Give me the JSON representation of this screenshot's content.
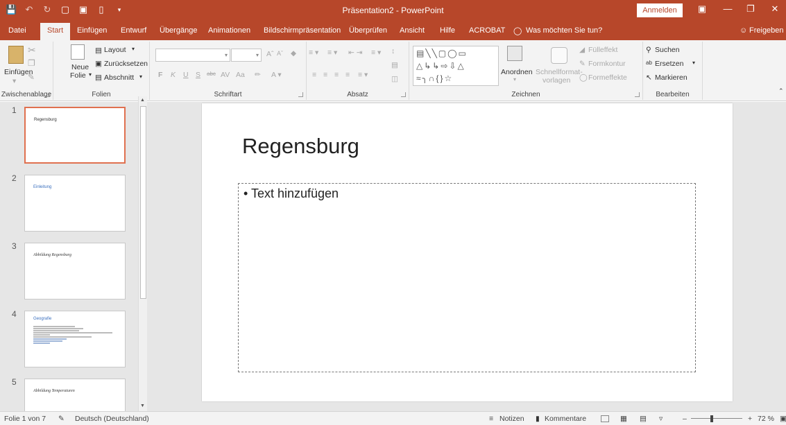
{
  "titlebar": {
    "title": "Präsentation2 - PowerPoint",
    "signin": "Anmelden"
  },
  "tabs": [
    "Datei",
    "Start",
    "Einfügen",
    "Entwurf",
    "Übergänge",
    "Animationen",
    "Bildschirmpräsentation",
    "Überprüfen",
    "Ansicht",
    "Hilfe",
    "ACROBAT"
  ],
  "tell_me": "Was möchten Sie tun?",
  "share": "Freigeben",
  "ribbon": {
    "clipboard": {
      "paste": "Einfügen",
      "label": "Zwischenablage"
    },
    "slides": {
      "new": "Neue",
      "new2": "Folie",
      "layout": "Layout",
      "reset": "Zurücksetzen",
      "section": "Abschnitt",
      "label": "Folien"
    },
    "font": {
      "label": "Schriftart",
      "bold": "F",
      "italic": "K",
      "underline": "U",
      "strike": "S",
      "aa": "Aa",
      "spacing": "AV"
    },
    "paragraph": {
      "label": "Absatz"
    },
    "drawing": {
      "arrange": "Anordnen",
      "quickstyles1": "Schnellformat-",
      "quickstyles2": "vorlagen",
      "fill": "Fülleffekt",
      "outline": "Formkontur",
      "effects": "Formeffekte",
      "label": "Zeichnen"
    },
    "editing": {
      "find": "Suchen",
      "replace": "Ersetzen",
      "select": "Markieren",
      "label": "Bearbeiten"
    }
  },
  "thumbnails": [
    {
      "num": "1",
      "title": "Regensburg"
    },
    {
      "num": "2",
      "title": "Einleitung"
    },
    {
      "num": "3",
      "title": "Abbildung Regensburg"
    },
    {
      "num": "4",
      "title": "Geografie"
    },
    {
      "num": "5",
      "title": "Abbildung Temperaturen"
    }
  ],
  "slide": {
    "title": "Regensburg",
    "bullet": "• Text hinzufügen"
  },
  "status": {
    "slide": "Folie 1 von 7",
    "language": "Deutsch (Deutschland)",
    "notes": "Notizen",
    "comments": "Kommentare",
    "zoom": "72 %"
  },
  "colors": {
    "accent": "#b7472a",
    "selection": "#e0704f"
  }
}
